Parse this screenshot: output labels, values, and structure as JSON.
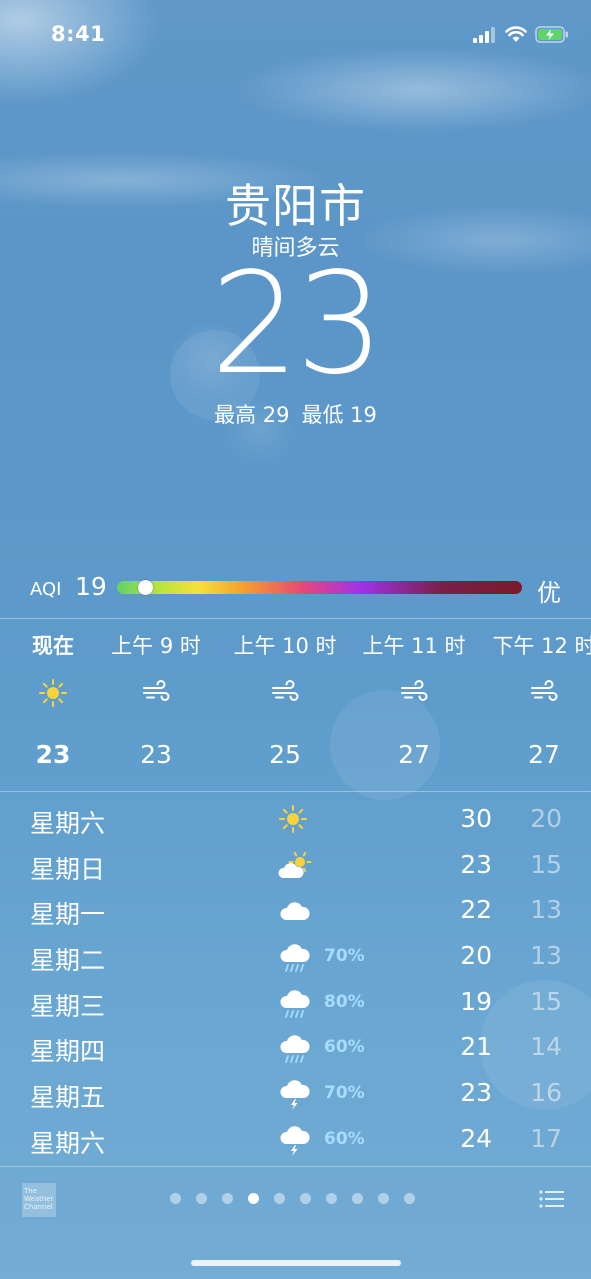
{
  "status": {
    "time": "8:41"
  },
  "location": {
    "city": "贵阳市",
    "condition": "晴间多云",
    "temperature": "23",
    "high": "最高 29",
    "low": "最低 19"
  },
  "aqi": {
    "label": "AQI",
    "value": "19",
    "rating": "优",
    "level_fraction": 0.07
  },
  "hourly": [
    {
      "label": "现在",
      "icon": "sun-icon",
      "temp": "23",
      "bold": true
    },
    {
      "label": "上午 9 时",
      "icon": "wind-icon",
      "temp": "23"
    },
    {
      "label": "上午 10 时",
      "icon": "wind-icon",
      "temp": "25"
    },
    {
      "label": "上午 11 时",
      "icon": "wind-icon",
      "temp": "27"
    },
    {
      "label": "下午 12 时",
      "icon": "wind-icon",
      "temp": "27"
    }
  ],
  "daily": [
    {
      "day": "星期六",
      "icon": "sun-icon",
      "precip": "",
      "high": "30",
      "low": "20"
    },
    {
      "day": "星期日",
      "icon": "partly-cloudy-icon",
      "precip": "",
      "high": "23",
      "low": "15"
    },
    {
      "day": "星期一",
      "icon": "cloud-icon",
      "precip": "",
      "high": "22",
      "low": "13"
    },
    {
      "day": "星期二",
      "icon": "rain-icon",
      "precip": "70%",
      "high": "20",
      "low": "13"
    },
    {
      "day": "星期三",
      "icon": "rain-icon",
      "precip": "80%",
      "high": "19",
      "low": "15"
    },
    {
      "day": "星期四",
      "icon": "rain-icon",
      "precip": "60%",
      "high": "21",
      "low": "14"
    },
    {
      "day": "星期五",
      "icon": "thunderstorm-icon",
      "precip": "70%",
      "high": "23",
      "low": "16"
    },
    {
      "day": "星期六",
      "icon": "thunderstorm-icon",
      "precip": "60%",
      "high": "24",
      "low": "17"
    }
  ],
  "footer": {
    "logo_text": "The Weather Channel",
    "page_count": 10,
    "active_page": 3
  },
  "colors": {
    "sun": "#f8d33a",
    "precip": "#a7dcff"
  }
}
